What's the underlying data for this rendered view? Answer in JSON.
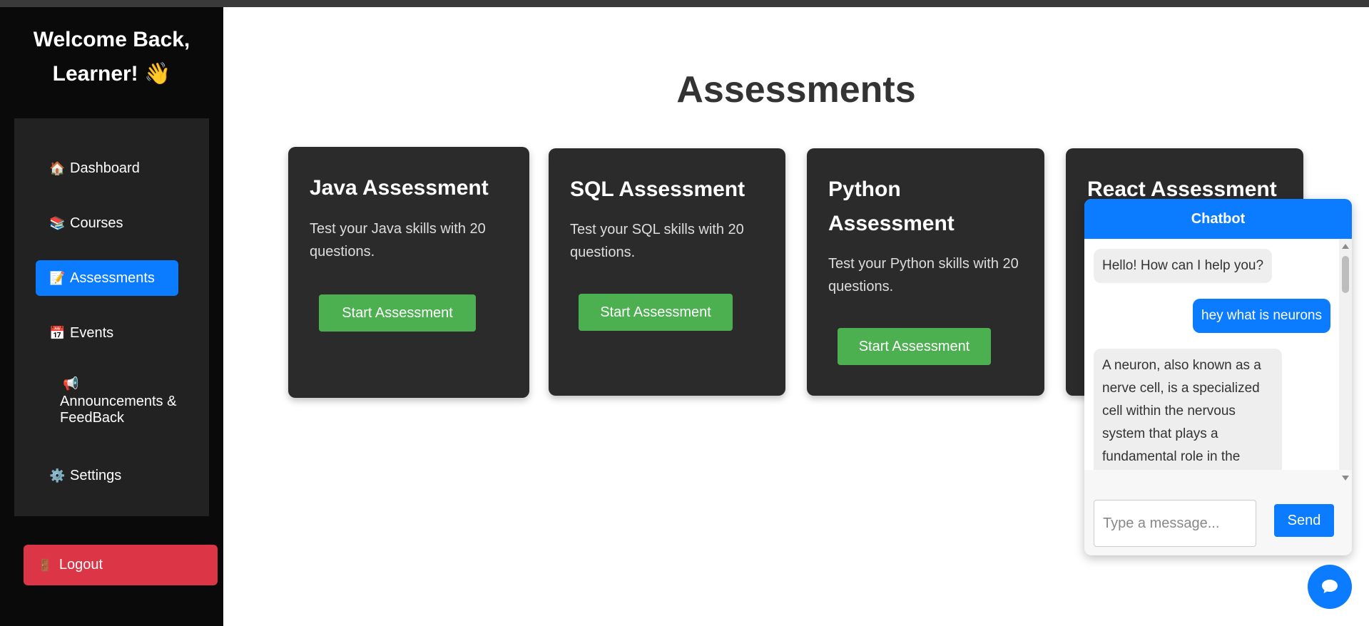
{
  "sidebar": {
    "welcome_line1": "Welcome Back,",
    "welcome_line2": "Learner! 👋",
    "items": [
      {
        "icon": "🏠",
        "label": "Dashboard"
      },
      {
        "icon": "📚",
        "label": "Courses"
      },
      {
        "icon": "📝",
        "label": "Assessments"
      },
      {
        "icon": "📅",
        "label": "Events"
      },
      {
        "icon": "📢",
        "label": "Announcements & FeedBack"
      },
      {
        "icon": "⚙️",
        "label": "Settings"
      }
    ],
    "logout": {
      "icon": "🚪",
      "label": "Logout"
    }
  },
  "main": {
    "title": "Assessments",
    "cards": [
      {
        "title": "Java Assessment",
        "description": "Test your Java skills with 20 questions.",
        "button": "Start Assessment"
      },
      {
        "title": "SQL Assessment",
        "description": "Test your SQL skills with 20 questions.",
        "button": "Start Assessment"
      },
      {
        "title": "Python Assessment",
        "description": "Test your Python skills with 20 questions.",
        "button": "Start Assessment"
      },
      {
        "title": "React Assessment",
        "description": "",
        "button": ""
      }
    ]
  },
  "chatbot": {
    "title": "Chatbot",
    "messages": [
      {
        "from": "bot",
        "text": "Hello! How can I help you?"
      },
      {
        "from": "user",
        "text": "hey what is neurons"
      },
      {
        "from": "bot",
        "text": "A neuron, also known as a nerve cell, is a specialized cell within the nervous system that plays a fundamental role in the transmission of electrical"
      }
    ],
    "input_placeholder": "Type a message...",
    "send_label": "Send"
  },
  "colors": {
    "sidebar_bg": "#0a0a0a",
    "accent": "#0b7bff",
    "success": "#4caf50",
    "danger": "#dc3545",
    "card_bg": "#2b2b2b"
  }
}
